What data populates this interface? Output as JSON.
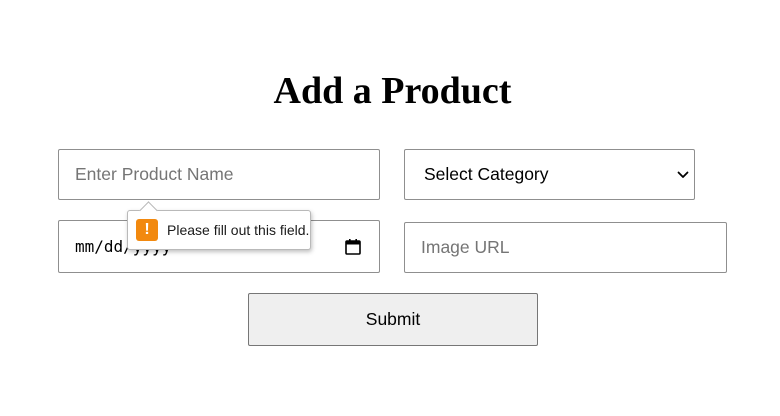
{
  "page": {
    "title": "Add a Product"
  },
  "form": {
    "product_name": {
      "placeholder": "Enter Product Name",
      "value": ""
    },
    "category": {
      "selected": "Select Category"
    },
    "date": {
      "display": "mm/dd/yyyy"
    },
    "image_url": {
      "placeholder": "Image URL",
      "value": ""
    },
    "submit_label": "Submit"
  },
  "validation": {
    "message": "Please fill out this field.",
    "icon": "warning-icon",
    "icon_glyph": "!",
    "icon_color": "#f2890f"
  },
  "icons": {
    "date_picker": "calendar-icon",
    "select": "chevron-down-icon"
  }
}
